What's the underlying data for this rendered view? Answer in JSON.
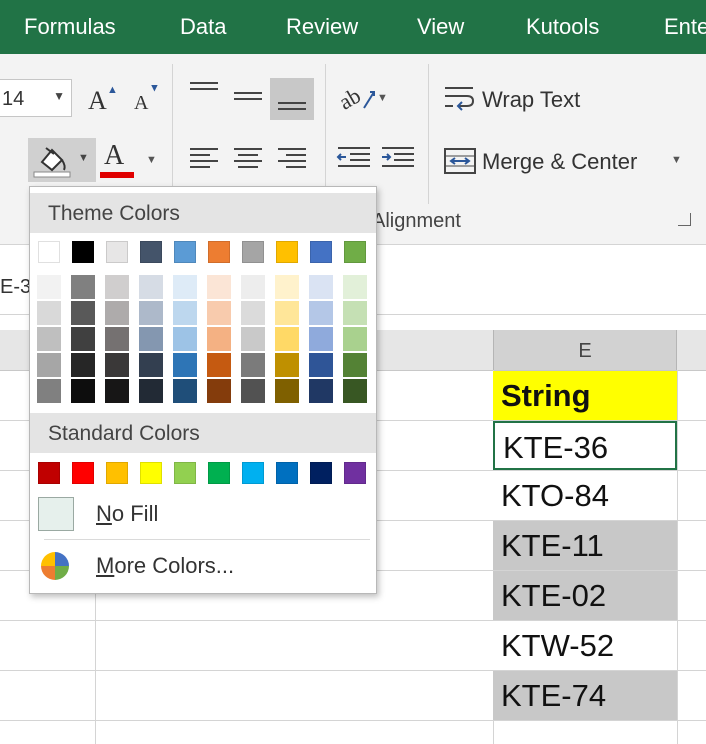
{
  "tabs": [
    "Formulas",
    "Data",
    "Review",
    "View",
    "Kutools",
    "Ente"
  ],
  "font": {
    "size": "14",
    "grow_glyph": "A",
    "shrink_glyph": "A",
    "color_glyph": "A",
    "color_bar": "#e00000"
  },
  "alignment": {
    "wrap_text": "Wrap Text",
    "merge_center": "Merge & Center",
    "group_label": "Alignment"
  },
  "namebox": {
    "value": "E-3"
  },
  "column_header": "E",
  "cells": [
    {
      "text": "String",
      "fill": "#ffff00",
      "bold": true,
      "selected": false
    },
    {
      "text": "KTE-36",
      "fill": "#ffffff",
      "bold": false,
      "selected": true
    },
    {
      "text": "KTO-84",
      "fill": "#ffffff",
      "bold": false,
      "selected": false
    },
    {
      "text": "KTE-11",
      "fill": "#c8c8c8",
      "bold": false,
      "selected": false
    },
    {
      "text": "KTE-02",
      "fill": "#c8c8c8",
      "bold": false,
      "selected": false
    },
    {
      "text": "KTW-52",
      "fill": "#ffffff",
      "bold": false,
      "selected": false
    },
    {
      "text": "KTE-74",
      "fill": "#c8c8c8",
      "bold": false,
      "selected": false
    }
  ],
  "fill_menu": {
    "theme_header": "Theme Colors",
    "standard_header": "Standard Colors",
    "no_fill": "No Fill",
    "no_fill_key": "N",
    "no_fill_rest": "o Fill",
    "more_colors": "More Colors...",
    "more_colors_key": "M",
    "more_colors_rest": "ore Colors...",
    "theme_colors": [
      "#ffffff",
      "#000000",
      "#e7e6e6",
      "#44546a",
      "#5b9bd5",
      "#ed7d31",
      "#a5a5a5",
      "#ffc000",
      "#4472c4",
      "#70ad47"
    ],
    "theme_tints": [
      [
        "#f2f2f2",
        "#d9d9d9",
        "#bfbfbf",
        "#a6a6a6",
        "#808080"
      ],
      [
        "#808080",
        "#595959",
        "#404040",
        "#262626",
        "#0d0d0d"
      ],
      [
        "#d0cece",
        "#aeabab",
        "#757171",
        "#3a3838",
        "#171616"
      ],
      [
        "#d6dce5",
        "#adb9ca",
        "#8497b0",
        "#333f50",
        "#222a35"
      ],
      [
        "#deebf7",
        "#bdd7ee",
        "#9dc3e6",
        "#2e75b6",
        "#1f4e79"
      ],
      [
        "#fbe5d6",
        "#f8cbad",
        "#f4b183",
        "#c55a11",
        "#843c0c"
      ],
      [
        "#ededed",
        "#dbdbdb",
        "#c9c9c9",
        "#7b7b7b",
        "#525252"
      ],
      [
        "#fff2cc",
        "#ffe699",
        "#ffd966",
        "#bf9000",
        "#7f6000"
      ],
      [
        "#dae3f3",
        "#b4c7e7",
        "#8faadc",
        "#2f5597",
        "#203864"
      ],
      [
        "#e2f0d9",
        "#c5e0b4",
        "#a9d18e",
        "#548235",
        "#385723"
      ]
    ],
    "standard_colors": [
      "#c00000",
      "#ff0000",
      "#ffc000",
      "#ffff00",
      "#92d050",
      "#00b050",
      "#00b0f0",
      "#0070c0",
      "#002060",
      "#7030a0"
    ]
  }
}
